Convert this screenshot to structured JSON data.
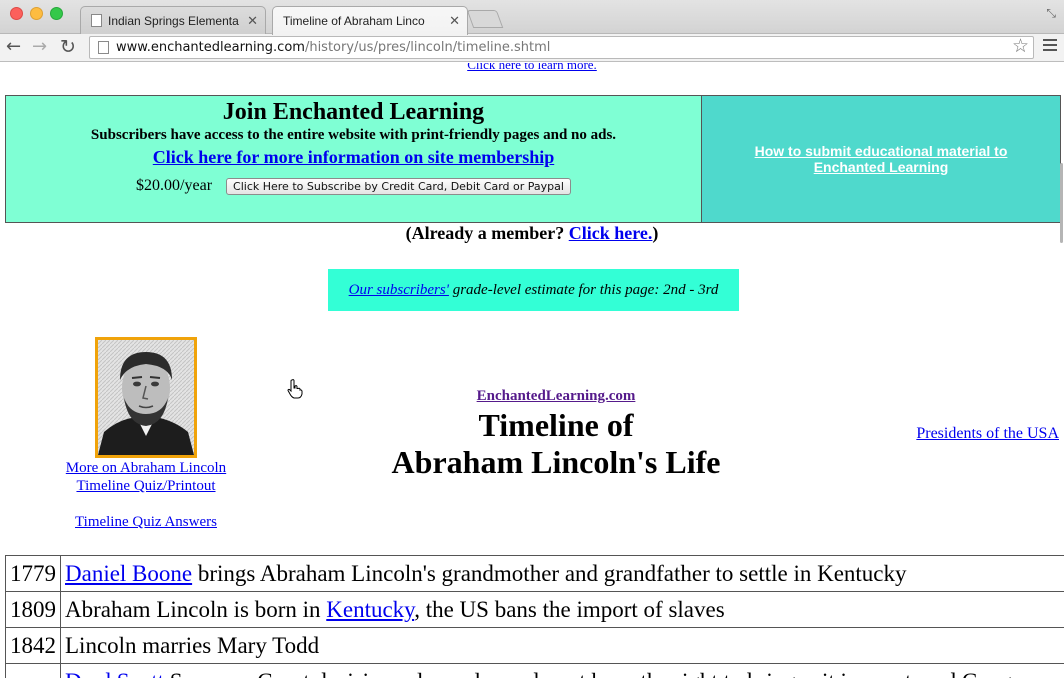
{
  "browser": {
    "tabs": [
      {
        "title": "Indian Springs Elementary",
        "active": false
      },
      {
        "title": "Timeline of Abraham Linco",
        "active": true
      }
    ],
    "url_host": "www.enchantedlearning.com",
    "url_path": "/history/us/pres/lincoln/timeline.shtml"
  },
  "page": {
    "learn_more": "Click here to learn more.",
    "join": {
      "title": "Join Enchanted Learning",
      "subtitle": "Subscribers have access to the entire website with print-friendly pages and no ads.",
      "membership_link": "Click here for more information on site membership",
      "price": "$20.00/year",
      "subscribe_button": "Click Here to Subscribe by Credit Card, Debit Card or Paypal",
      "submit_link": "How to submit educational material to Enchanted Learning"
    },
    "member": {
      "prefix": "(Already a member? ",
      "link": "Click here.",
      "suffix": ")"
    },
    "grade": {
      "link": "Our subscribers'",
      "text": " grade-level estimate for this page: 2nd - 3rd"
    },
    "left_links": {
      "more": "More on Abraham Lincoln",
      "quiz": "Timeline Quiz/Printout",
      "answers": "Timeline Quiz Answers"
    },
    "site_link": "EnchantedLearning.com",
    "title_line1": "Timeline of",
    "title_line2": "Abraham Lincoln's Life",
    "presidents_link": "Presidents of the USA",
    "timeline": [
      {
        "year": "1779",
        "link": "Daniel Boone",
        "text": " brings Abraham Lincoln's grandmother and grandfather to settle in Kentucky"
      },
      {
        "year": "1809",
        "pre": "Abraham Lincoln is born in ",
        "link": "Kentucky",
        "text": ", the US bans the import of slaves"
      },
      {
        "year": "1842",
        "text": "Lincoln marries Mary Todd"
      },
      {
        "year": "",
        "link": "Dred Scott",
        "text": " Supreme Court decision rules... slaves do not have the right to bring suit in court, and Congress cannot"
      }
    ]
  }
}
